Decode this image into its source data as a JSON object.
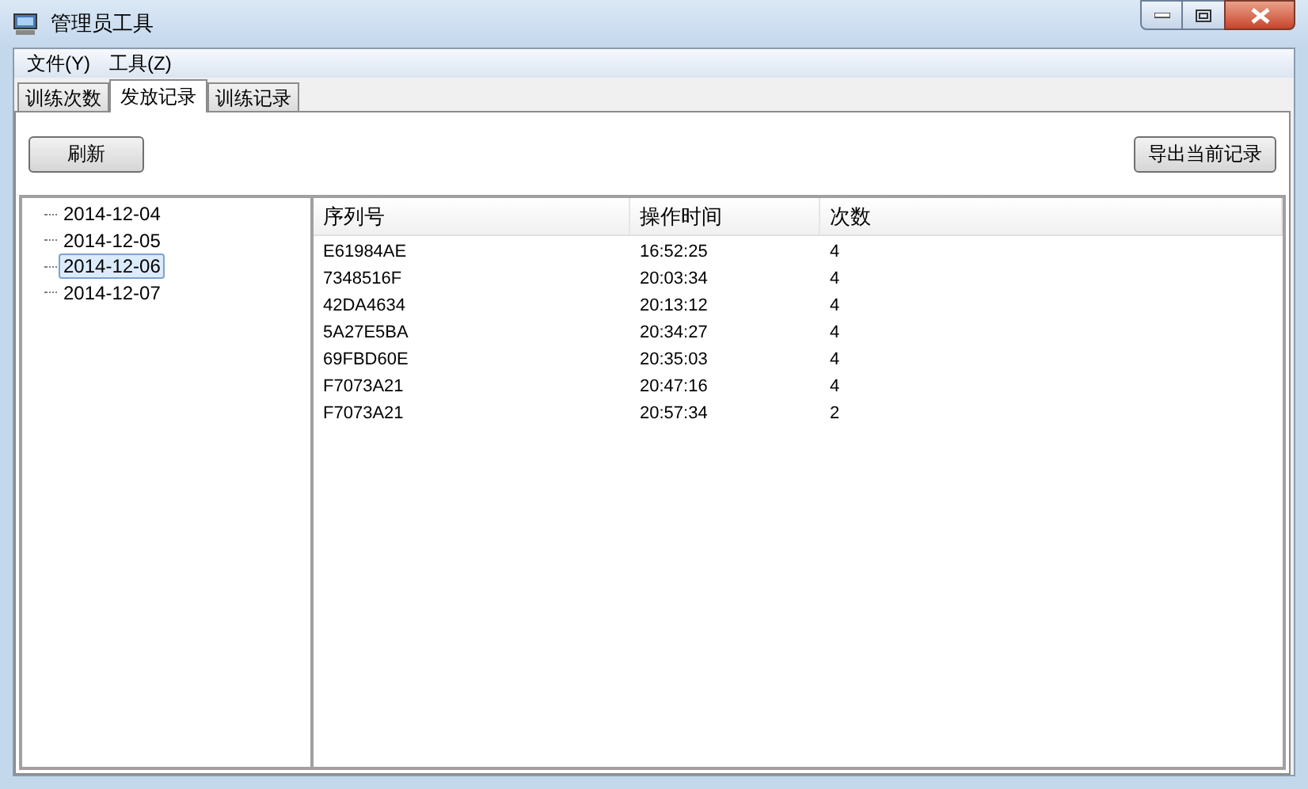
{
  "window": {
    "title": "管理员工具"
  },
  "menu": [
    {
      "label": "文件(Y)"
    },
    {
      "label": "工具(Z)"
    }
  ],
  "tabs": [
    {
      "label": "训练次数",
      "selected": false
    },
    {
      "label": "发放记录",
      "selected": true
    },
    {
      "label": "训练记录",
      "selected": false
    }
  ],
  "buttons": {
    "refresh": "刷新",
    "export": "导出当前记录"
  },
  "tree": [
    {
      "label": "2014-12-04",
      "selected": false
    },
    {
      "label": "2014-12-05",
      "selected": false
    },
    {
      "label": "2014-12-06",
      "selected": true
    },
    {
      "label": "2014-12-07",
      "selected": false
    }
  ],
  "table": {
    "columns": [
      "序列号",
      "操作时间",
      "次数"
    ],
    "rows": [
      [
        "E61984AE",
        "16:52:25",
        "4"
      ],
      [
        "7348516F",
        "20:03:34",
        "4"
      ],
      [
        "42DA4634",
        "20:13:12",
        "4"
      ],
      [
        "5A27E5BA",
        "20:34:27",
        "4"
      ],
      [
        "69FBD60E",
        "20:35:03",
        "4"
      ],
      [
        "F7073A21",
        "20:47:16",
        "4"
      ],
      [
        "F7073A21",
        "20:57:34",
        "2"
      ]
    ]
  }
}
